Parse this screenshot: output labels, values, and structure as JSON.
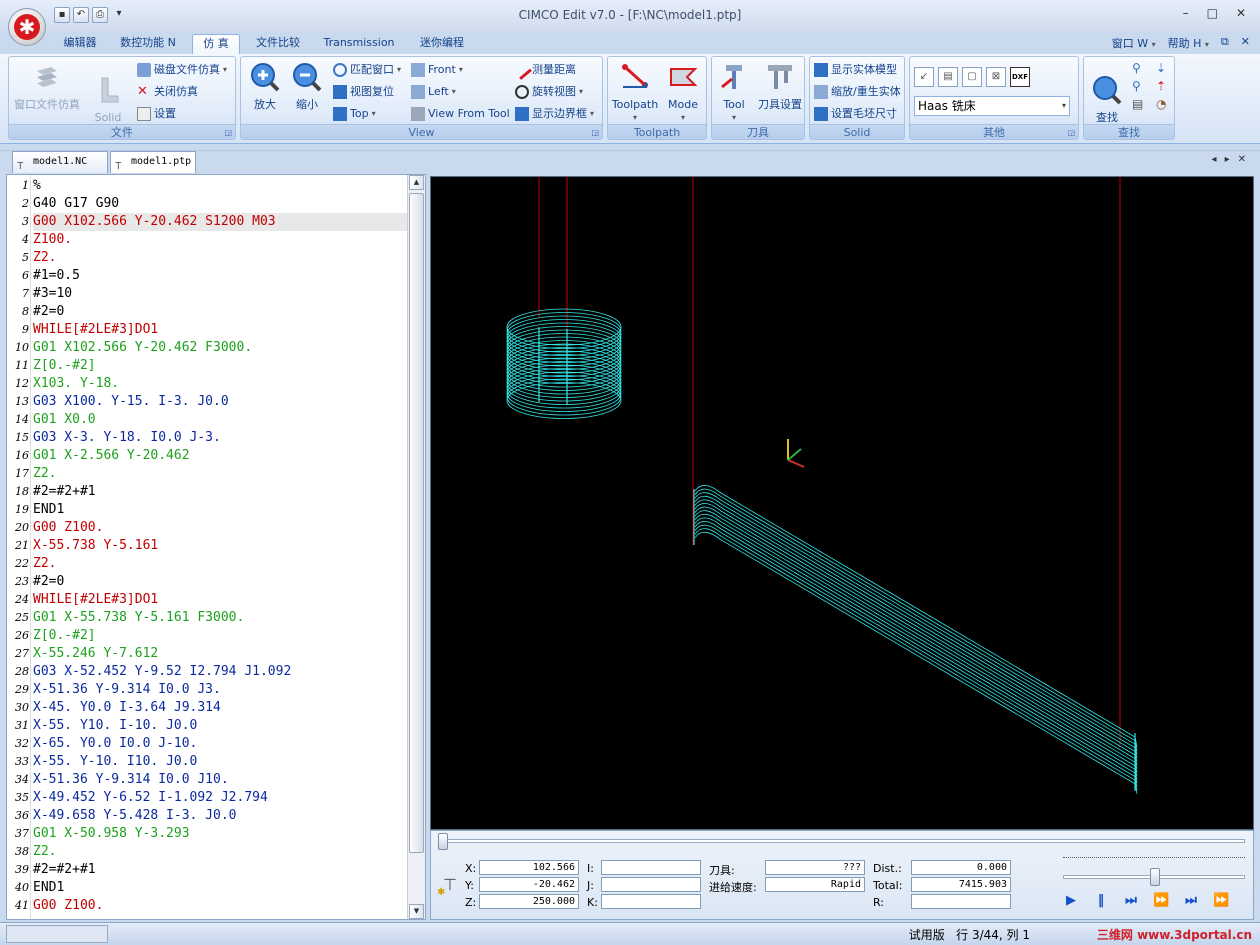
{
  "window": {
    "title": "CIMCO Edit v7.0 - [F:\\NC\\model1.ptp]"
  },
  "ribbon_tabs": [
    "编辑器",
    "数控功能 N",
    "仿 真",
    "文件比较",
    "Transmission",
    "迷你编程"
  ],
  "ribbon_right": {
    "window_menu": "窗口 W",
    "help_menu": "帮助 H"
  },
  "groups": {
    "file": {
      "label": "文件",
      "window_sim": "窗口文件仿真",
      "solid_animation": "Solid\nAnimation",
      "disk_sim": "磁盘文件仿真",
      "close_sim": "关闭仿真",
      "settings": "设置"
    },
    "view": {
      "label": "View",
      "zoom_in": "放大",
      "zoom_out": "缩小",
      "fit_window": "匹配窗口",
      "reset_view": "视图复位",
      "top": "Top",
      "front": "Front",
      "left": "Left",
      "view_from_tool": "View From Tool",
      "measure": "测量距离",
      "rotate_view": "旋转视图",
      "show_bbox": "显示边界框"
    },
    "toolpath": {
      "label": "Toolpath",
      "toolpath": "Toolpath",
      "mode": "Mode"
    },
    "tool": {
      "label": "刀具",
      "tool": "Tool",
      "tool_setup": "刀具设置"
    },
    "solid": {
      "label": "Solid",
      "show_solid": "显示实体模型",
      "zoom_regen": "缩放/重生实体",
      "stock_size": "设置毛坯尺寸"
    },
    "other": {
      "label": "其他",
      "machine": "Haas 铣床",
      "dxf": "DXF"
    },
    "find": {
      "label": "查找",
      "find": "查找\nF"
    }
  },
  "doc_tabs": [
    "model1.NC",
    "model1.ptp"
  ],
  "code_lines": [
    {
      "t": "%",
      "c": "#000000"
    },
    {
      "t": "G40 G17 G90",
      "c": "#000000"
    },
    {
      "t": "G00 X102.566 Y-20.462 S1200 M03",
      "c": "#c00000"
    },
    {
      "t": "Z100.",
      "c": "#c00000"
    },
    {
      "t": "Z2.",
      "c": "#c00000"
    },
    {
      "t": "#1=0.5",
      "c": "#000000"
    },
    {
      "t": "#3=10",
      "c": "#000000"
    },
    {
      "t": "#2=0",
      "c": "#000000"
    },
    {
      "t": "WHILE[#2LE#3]DO1",
      "c": "#c00000"
    },
    {
      "t": "G01 X102.566 Y-20.462 F3000.",
      "c": "#1ea01e"
    },
    {
      "t": "Z[0.-#2]",
      "c": "#1ea01e"
    },
    {
      "t": "X103. Y-18.",
      "c": "#1ea01e"
    },
    {
      "t": "G03 X100. Y-15. I-3. J0.0",
      "c": "#0a2a9e"
    },
    {
      "t": "G01 X0.0",
      "c": "#1ea01e"
    },
    {
      "t": "G03 X-3. Y-18. I0.0 J-3.",
      "c": "#0a2a9e"
    },
    {
      "t": "G01 X-2.566 Y-20.462",
      "c": "#1ea01e"
    },
    {
      "t": "Z2.",
      "c": "#1ea01e"
    },
    {
      "t": "#2=#2+#1",
      "c": "#000000"
    },
    {
      "t": "END1",
      "c": "#000000"
    },
    {
      "t": "G00 Z100.",
      "c": "#c00000"
    },
    {
      "t": "X-55.738 Y-5.161",
      "c": "#c00000"
    },
    {
      "t": "Z2.",
      "c": "#c00000"
    },
    {
      "t": "#2=0",
      "c": "#000000"
    },
    {
      "t": "WHILE[#2LE#3]DO1",
      "c": "#c00000"
    },
    {
      "t": "G01 X-55.738 Y-5.161 F3000.",
      "c": "#1ea01e"
    },
    {
      "t": "Z[0.-#2]",
      "c": "#1ea01e"
    },
    {
      "t": "X-55.246 Y-7.612",
      "c": "#1ea01e"
    },
    {
      "t": "G03 X-52.452 Y-9.52 I2.794 J1.092",
      "c": "#0a2a9e"
    },
    {
      "t": "X-51.36 Y-9.314 I0.0 J3.",
      "c": "#0a2a9e"
    },
    {
      "t": "X-45. Y0.0 I-3.64 J9.314",
      "c": "#0a2a9e"
    },
    {
      "t": "X-55. Y10. I-10. J0.0",
      "c": "#0a2a9e"
    },
    {
      "t": "X-65. Y0.0 I0.0 J-10.",
      "c": "#0a2a9e"
    },
    {
      "t": "X-55. Y-10. I10. J0.0",
      "c": "#0a2a9e"
    },
    {
      "t": "X-51.36 Y-9.314 I0.0 J10.",
      "c": "#0a2a9e"
    },
    {
      "t": "X-49.452 Y-6.52 I-1.092 J2.794",
      "c": "#0a2a9e"
    },
    {
      "t": "X-49.658 Y-5.428 I-3. J0.0",
      "c": "#0a2a9e"
    },
    {
      "t": "G01 X-50.958 Y-3.293",
      "c": "#1ea01e"
    },
    {
      "t": "Z2.",
      "c": "#1ea01e"
    },
    {
      "t": "#2=#2+#1",
      "c": "#000000"
    },
    {
      "t": "END1",
      "c": "#000000"
    },
    {
      "t": "G00 Z100.",
      "c": "#c00000"
    }
  ],
  "current_line": 3,
  "sim_panel": {
    "x_label": "X:",
    "x_value": "102.566",
    "y_label": "Y:",
    "y_value": "-20.462",
    "z_label": "Z:",
    "z_value": "250.000",
    "i_label": "I:",
    "j_label": "J:",
    "k_label": "K:",
    "tool_label": "刀具:",
    "tool_value": "???",
    "feed_label": "进给速度:",
    "feed_value": "Rapid",
    "dist_label": "Dist.:",
    "dist_value": "0.000",
    "total_label": "Total:",
    "total_value": "7415.903",
    "r_label": "R:"
  },
  "status": {
    "trial": "试用版",
    "position": "行 3/44, 列 1",
    "watermark": "三维网 www.3dportal.cn"
  },
  "colors": {
    "toolpath": "#33e6e6",
    "rapid": "#c00000",
    "background": "#000000"
  }
}
